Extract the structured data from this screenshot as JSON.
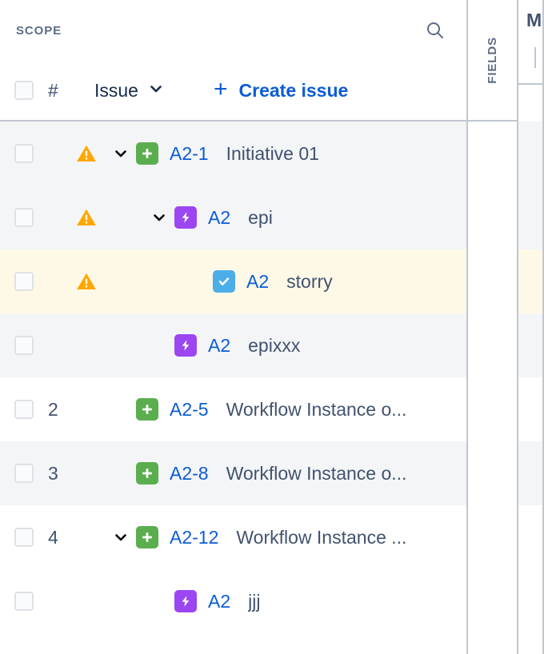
{
  "scope": {
    "title": "SCOPE",
    "search_icon": "search-icon",
    "columns": {
      "select_all_checkbox": "",
      "number_header": "#",
      "issue_filter_label": "Issue",
      "issue_filter_chevron": "chevron-down-icon",
      "create_issue_label": "Create issue",
      "create_issue_plus": "+"
    },
    "rows": [
      {
        "num": "",
        "warning": true,
        "twisty": "expanded",
        "indent": 0,
        "type": "initiative",
        "type_icon": "initiative-icon",
        "key": "A2-1",
        "summary": "Initiative 01",
        "bg": "bg-grey"
      },
      {
        "num": "",
        "warning": true,
        "twisty": "expanded",
        "indent": 1,
        "type": "epic",
        "type_icon": "epic-icon",
        "key": "A2",
        "summary": "epi",
        "bg": "bg-grey"
      },
      {
        "num": "",
        "warning": true,
        "twisty": "none",
        "indent": 2,
        "type": "story",
        "type_icon": "story-icon",
        "key": "A2",
        "summary": "storry",
        "bg": "bg-yellow"
      },
      {
        "num": "",
        "warning": false,
        "twisty": "none",
        "indent": 1,
        "type": "epic",
        "type_icon": "epic-icon",
        "key": "A2",
        "summary": "epixxx",
        "bg": "bg-grey"
      },
      {
        "num": "2",
        "warning": false,
        "twisty": "none",
        "indent": 0,
        "type": "initiative",
        "type_icon": "initiative-icon",
        "key": "A2-5",
        "summary": "Workflow Instance o...",
        "bg": "bg-white"
      },
      {
        "num": "3",
        "warning": false,
        "twisty": "none",
        "indent": 0,
        "type": "initiative",
        "type_icon": "initiative-icon",
        "key": "A2-8",
        "summary": "Workflow Instance o...",
        "bg": "bg-grey"
      },
      {
        "num": "4",
        "warning": false,
        "twisty": "expanded",
        "indent": 0,
        "type": "initiative",
        "type_icon": "initiative-icon",
        "key": "A2-12",
        "summary": "Workflow Instance ...",
        "bg": "bg-white"
      },
      {
        "num": "",
        "warning": false,
        "twisty": "none",
        "indent": 1,
        "type": "epic",
        "type_icon": "epic-icon",
        "key": "A2",
        "summary": "jjj",
        "bg": "bg-white"
      }
    ]
  },
  "fields": {
    "label": "FIELDS"
  },
  "right_panel": {
    "title": "M"
  },
  "colors": {
    "link_blue": "#0B5CD5",
    "initiative_green": "#5AAE4E",
    "epic_purple": "#9C46F2",
    "story_blue": "#4BAEE8",
    "warning_amber": "#FFA700",
    "row_grey": "#F4F5F7",
    "row_highlight_yellow": "#FEF9E7",
    "border_grey": "#C1C7D0",
    "text_dark": "#42526E",
    "text_muted": "#5E6C84"
  }
}
